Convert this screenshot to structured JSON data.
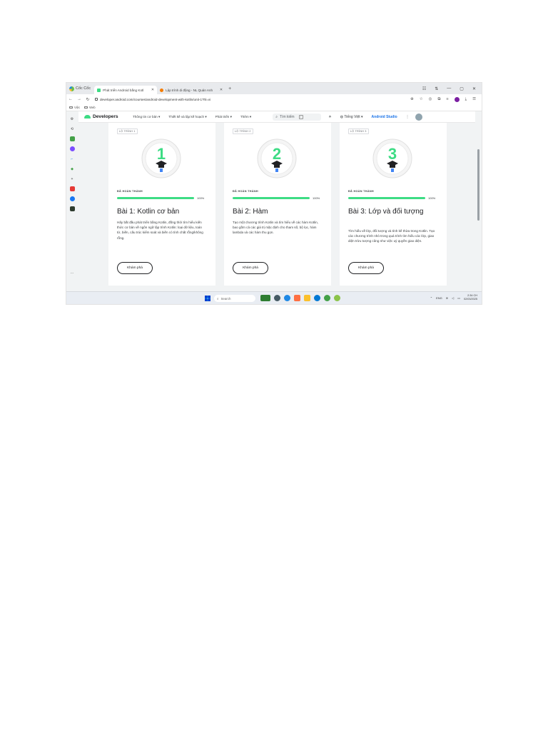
{
  "browser": {
    "name": "Cốc Cốc",
    "tabs": [
      {
        "label": "Phát triển Android bằng Kotl",
        "active": true
      },
      {
        "label": "Lập trình di động - NL Quản Anh",
        "active": false
      }
    ],
    "url": "developer.android.com/courses/android-development-with-kotlin/unit-1?hl=vi",
    "bookmarks": [
      "Việc",
      "Web"
    ]
  },
  "site": {
    "brand": "Developers",
    "menu": [
      "Thông tin cơ bản ▾",
      "Thiết kế và lập kế hoạch ▾",
      "Phát triển ▾",
      "Thêm ▾"
    ],
    "search_placeholder": "Tìm kiếm",
    "search_shortcut": "/",
    "language": "Tiếng Việt ▾",
    "studio": "Android Studio"
  },
  "cards": [
    {
      "step": "LỘ TRÌNH 1",
      "number": "1",
      "status": "ĐÃ HOÀN THÀNH",
      "progress": 100,
      "progress_label": "100%",
      "title": "Bài 1: Kotlin cơ bản",
      "description": "Hãy bắt đầu phát triển bằng Kotlin, đồng thời tìm hiểu kiến thức cơ bản về ngôn ngữ lập trình Kotlin: loại dữ liệu, toán tử, biến, cấu trúc kiểm soát và biến có tính chất rỗng/không rỗng.",
      "button": "Khám phá"
    },
    {
      "step": "LỘ TRÌNH 2",
      "number": "2",
      "status": "ĐÃ HOÀN THÀNH",
      "progress": 100,
      "progress_label": "100%",
      "title": "Bài 2: Hàm",
      "description": "Tạo một chương trình Kotlin và tìm hiểu về các hàm Kotlin, bao gồm cả các giá trị mặc định cho tham số, bộ lọc, hàm lambda và các hàm thu gọn.",
      "button": "Khám phá"
    },
    {
      "step": "LỘ TRÌNH 3",
      "number": "3",
      "status": "ĐÃ HOÀN THÀNH",
      "progress": 100,
      "progress_label": "100%",
      "title": "Bài 3: Lớp và đối tượng",
      "description": "Tìm hiểu về lớp, đối tượng và tính kế thừa trong Kotlin. Tạo các chương trình nhỏ trong quá trình tìm hiểu các lớp, giao diện trừu tượng cũng như việc uỷ quyền giao diện.",
      "button": "Khám phá"
    }
  ],
  "taskbar": {
    "search_placeholder": "Search",
    "lang": "ENG",
    "time": "2:34 CH",
    "date": "02/03/2025"
  },
  "colors": {
    "accent": "#3ddc84",
    "link": "#1a73e8"
  }
}
